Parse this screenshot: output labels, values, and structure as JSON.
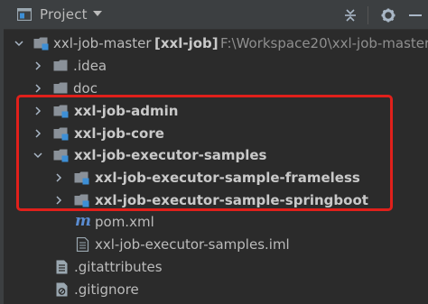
{
  "header": {
    "title": "Project"
  },
  "tree": {
    "root": {
      "name": "xxl-job-master",
      "module": "[xxl-job]",
      "path": "F:\\Workspace20\\xxl-job-master"
    },
    "idea": "idea",
    "idea_dot": ".",
    "doc": "doc",
    "admin": "xxl-job-admin",
    "core": "xxl-job-core",
    "samples": "xxl-job-executor-samples",
    "frameless": "xxl-job-executor-sample-frameless",
    "springboot": "xxl-job-executor-sample-springboot",
    "pom": "pom.xml",
    "iml": "xxl-job-executor-samples.iml",
    "gitattributes": ".gitattributes",
    "gitignore": ".gitignore"
  },
  "colors": {
    "background": "#2b2b2b",
    "header": "#3c3f41",
    "module_badge": "#3d8fd6",
    "highlight": "#e0201b"
  },
  "icons": [
    "project-icon",
    "chevron-down-icon",
    "collapse-all-icon",
    "gear-icon",
    "hide-icon",
    "folder-icon",
    "module-folder-icon",
    "maven-icon",
    "iml-file-icon",
    "text-file-icon",
    "gitignore-file-icon",
    "chevron-right-icon"
  ]
}
